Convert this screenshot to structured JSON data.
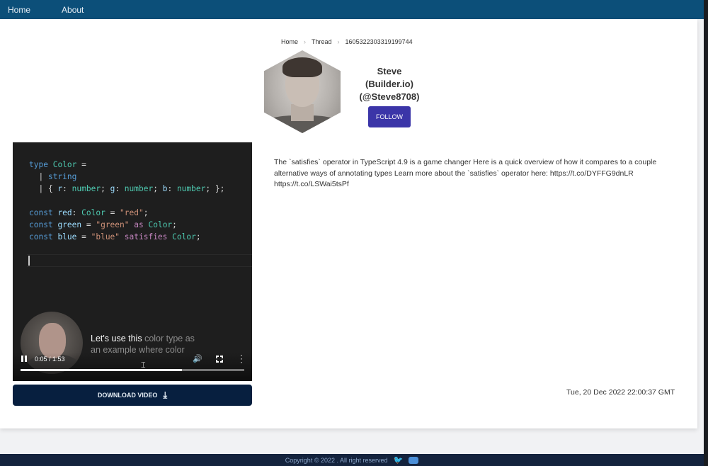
{
  "nav": {
    "items": [
      "Home",
      "About"
    ]
  },
  "breadcrumb": {
    "home": "Home",
    "thread": "Thread",
    "id": "1605322303319199744"
  },
  "profile": {
    "name_line1": "Steve",
    "name_line2": "(Builder.io)",
    "handle": "(@Steve8708)",
    "follow_label": "FOLLOW"
  },
  "video": {
    "code_lines": [
      "type Color =",
      "  | string",
      "  | { r: number; g: number; b: number; };",
      "",
      "const red: Color = \"red\";",
      "const green = \"green\" as Color;",
      "const blue = \"blue\" satisfies Color;"
    ],
    "caption_bright": "Let's use this",
    "caption_dim1": "color type as",
    "caption_dim2": "an example where color",
    "time": "0:05 / 1:53",
    "progress": 0.72
  },
  "download_label": "DOWNLOAD VIDEO",
  "tweet_text": "The `satisfies` operator in TypeScript 4.9 is a game changer Here is a quick overview of how it compares to a couple alternative ways of annotating types Learn more about the `satisfies` operator here: https://t.co/DYFFG9dnLR https://t.co/LSWai5tsPf",
  "timestamp": "Tue, 20 Dec 2022 22:00:37 GMT",
  "footer": {
    "copyright": "Copyright © 2022 . All right reserved"
  },
  "colors": {
    "nav_bg": "#0c4f79",
    "follow_bg": "#3b35a8",
    "download_bg": "#071f3f"
  }
}
